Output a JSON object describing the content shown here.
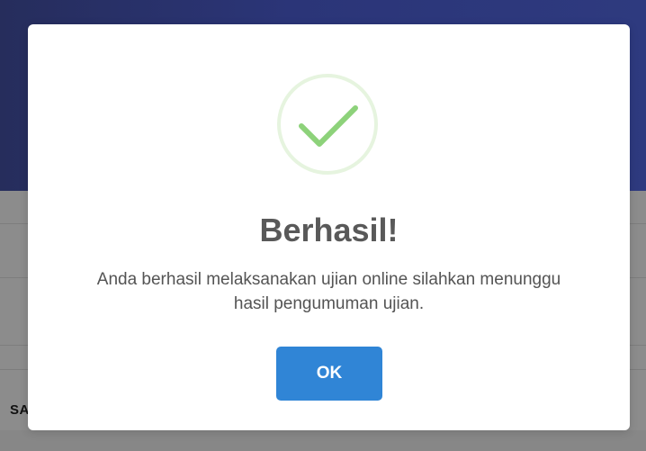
{
  "background": {
    "partial_label": "SA"
  },
  "modal": {
    "icon": "success-checkmark-icon",
    "title": "Berhasil!",
    "text": "Anda berhasil melaksanakan ujian online silahkan menunggu hasil pengumuman ujian.",
    "ok_label": "OK"
  },
  "colors": {
    "header": "#2e3a7f",
    "confirm_button": "#3085d6",
    "success_ring": "#e6f4df",
    "success_check": "#8dd27a"
  }
}
